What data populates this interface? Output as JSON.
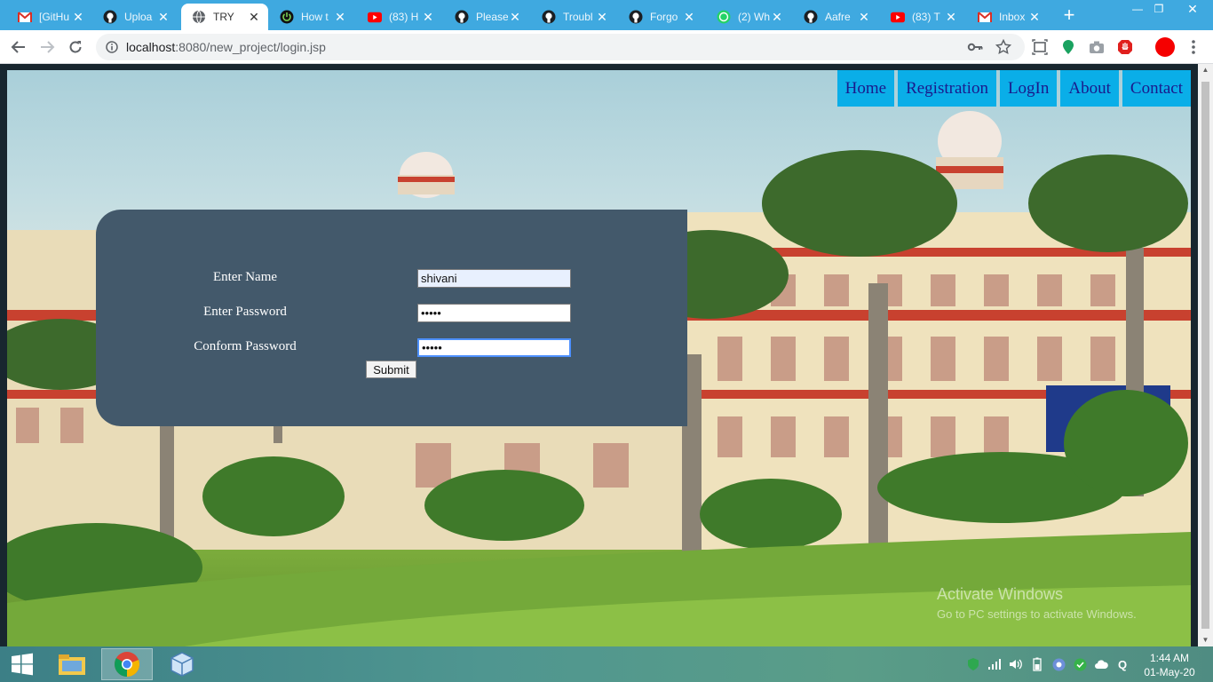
{
  "browser": {
    "tabs": [
      {
        "title": "[GitHu",
        "icon": "gmail-icon",
        "active": false
      },
      {
        "title": "Uploa",
        "icon": "github-icon",
        "active": false
      },
      {
        "title": "TRY",
        "icon": "globe-icon",
        "active": true
      },
      {
        "title": "How t",
        "icon": "power-icon",
        "active": false
      },
      {
        "title": "(83) H",
        "icon": "youtube-icon",
        "active": false
      },
      {
        "title": "Please",
        "icon": "github-icon",
        "active": false
      },
      {
        "title": "Troubl",
        "icon": "github-icon",
        "active": false
      },
      {
        "title": "Forgo",
        "icon": "github-icon",
        "active": false
      },
      {
        "title": "(2) Wh",
        "icon": "whatsapp-icon",
        "active": false
      },
      {
        "title": "Aafre",
        "icon": "github-icon",
        "active": false
      },
      {
        "title": "(83) T",
        "icon": "youtube-icon",
        "active": false
      },
      {
        "title": "Inbox",
        "icon": "gmail-icon",
        "active": false
      }
    ],
    "new_tab": "+",
    "window_controls": {
      "minimize": "—",
      "restore": "❐",
      "close": "✕"
    },
    "url_host": "localhost",
    "url_rest": ":8080/new_project/login.jsp"
  },
  "site": {
    "nav": [
      "Home",
      "Registration",
      "LogIn",
      "About",
      "Contact"
    ],
    "form": {
      "name_label": "Enter Name",
      "name_value": "shivani",
      "password_label": "Enter Password",
      "password_value": "•••••",
      "confirm_label": "Conform Password",
      "confirm_value": "•••••",
      "submit_label": "Submit"
    },
    "watermark_line1": "Activate Windows",
    "watermark_line2": "Go to PC settings to activate Windows."
  },
  "taskbar": {
    "time": "1:44 AM",
    "date": "01-May-20"
  },
  "colors": {
    "tab_strip": "#3fa9e0",
    "nav_bg": "#0aaee8",
    "nav_text": "#1a1a8c",
    "login_box": "#43596b"
  }
}
